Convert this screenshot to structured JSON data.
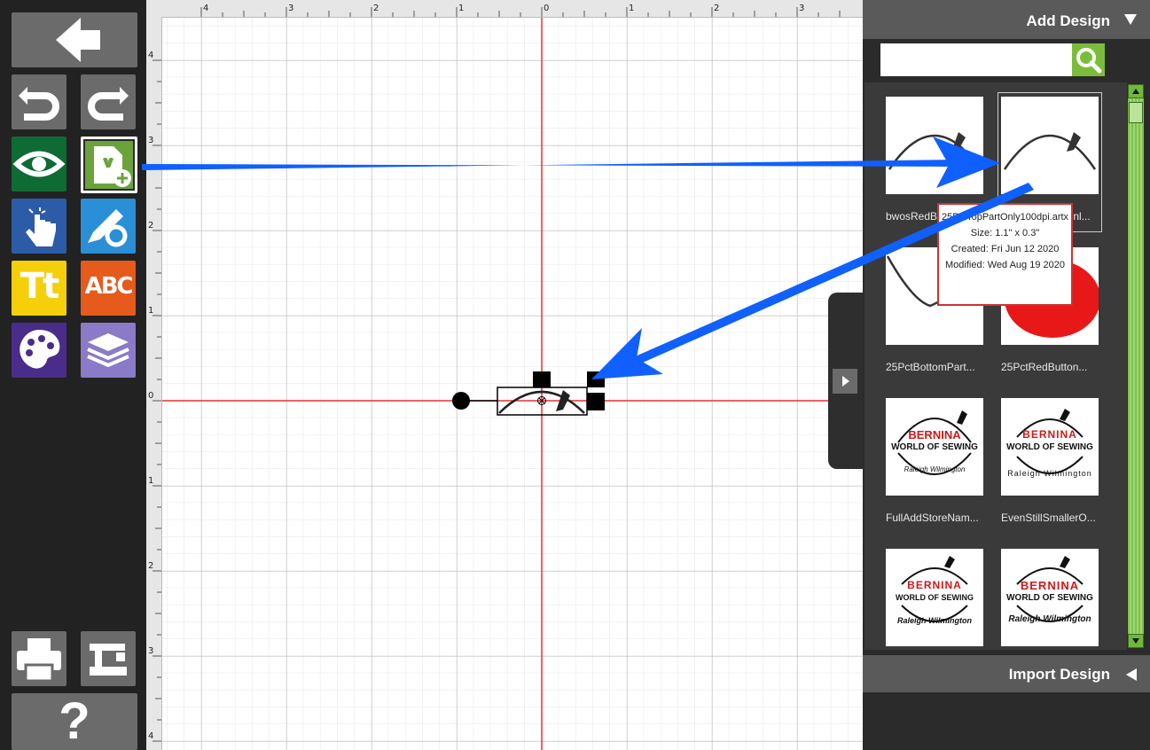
{
  "toolbar": {
    "buttons": [
      {
        "name": "back-button",
        "icon": "arrow-left-icon"
      },
      {
        "name": "undo-button",
        "icon": "undo-icon"
      },
      {
        "name": "redo-button",
        "icon": "redo-icon"
      },
      {
        "name": "view-button",
        "icon": "eye-icon"
      },
      {
        "name": "add-design-button",
        "icon": "add-design-icon"
      },
      {
        "name": "select-button",
        "icon": "hand-pointer-icon"
      },
      {
        "name": "edit-button",
        "icon": "pencil-gear-icon"
      },
      {
        "name": "text-button",
        "icon": "text-icon"
      },
      {
        "name": "monogram-button",
        "icon": "monogram-icon"
      },
      {
        "name": "color-button",
        "icon": "palette-icon"
      },
      {
        "name": "layers-button",
        "icon": "layers-icon"
      },
      {
        "name": "print-button",
        "icon": "printer-icon"
      },
      {
        "name": "send-to-machine-button",
        "icon": "sewing-machine-icon"
      },
      {
        "name": "help-button",
        "icon": "question-icon"
      }
    ],
    "text_button_label": "Tt",
    "monogram_button_label": "ABC",
    "help_label": "?"
  },
  "ruler": {
    "top_labels": [
      "4",
      "3",
      "2",
      "1",
      "0",
      "1",
      "2",
      "3"
    ],
    "left_labels": [
      "4",
      "3",
      "2",
      "1",
      "0",
      "1",
      "2",
      "3",
      "4"
    ]
  },
  "panel": {
    "add_design_label": "Add Design",
    "import_design_label": "Import Design",
    "search": {
      "value": "",
      "placeholder": ""
    },
    "thumbnails": [
      {
        "label": "bwosRedB"
      },
      {
        "label": "25PctTopPartOnl..."
      },
      {
        "label": ""
      },
      {
        "label": ""
      },
      {
        "label": "25PctBottomPart..."
      },
      {
        "label": "25PctRedButton..."
      },
      {
        "label": "FullAddStoreNam..."
      },
      {
        "label": "EvenStillSmallerO..."
      },
      {
        "label": ""
      },
      {
        "label": ""
      }
    ],
    "logo_text": {
      "brand": "BERNINA",
      "tagline": "WORLD OF SEWING",
      "location": "Raleigh Wilmington"
    }
  },
  "tooltip": {
    "filename": "25PctTopPartOnly100dpi.artx",
    "size": "Size: 1.1\" x 0.3\"",
    "created": "Created: Fri Jun 12 2020",
    "modified": "Modified: Wed Aug 19 2020"
  },
  "colors": {
    "accent_green": "#7bbd3a",
    "arrow_blue": "#1060ff",
    "axis_red": "#e53030"
  }
}
